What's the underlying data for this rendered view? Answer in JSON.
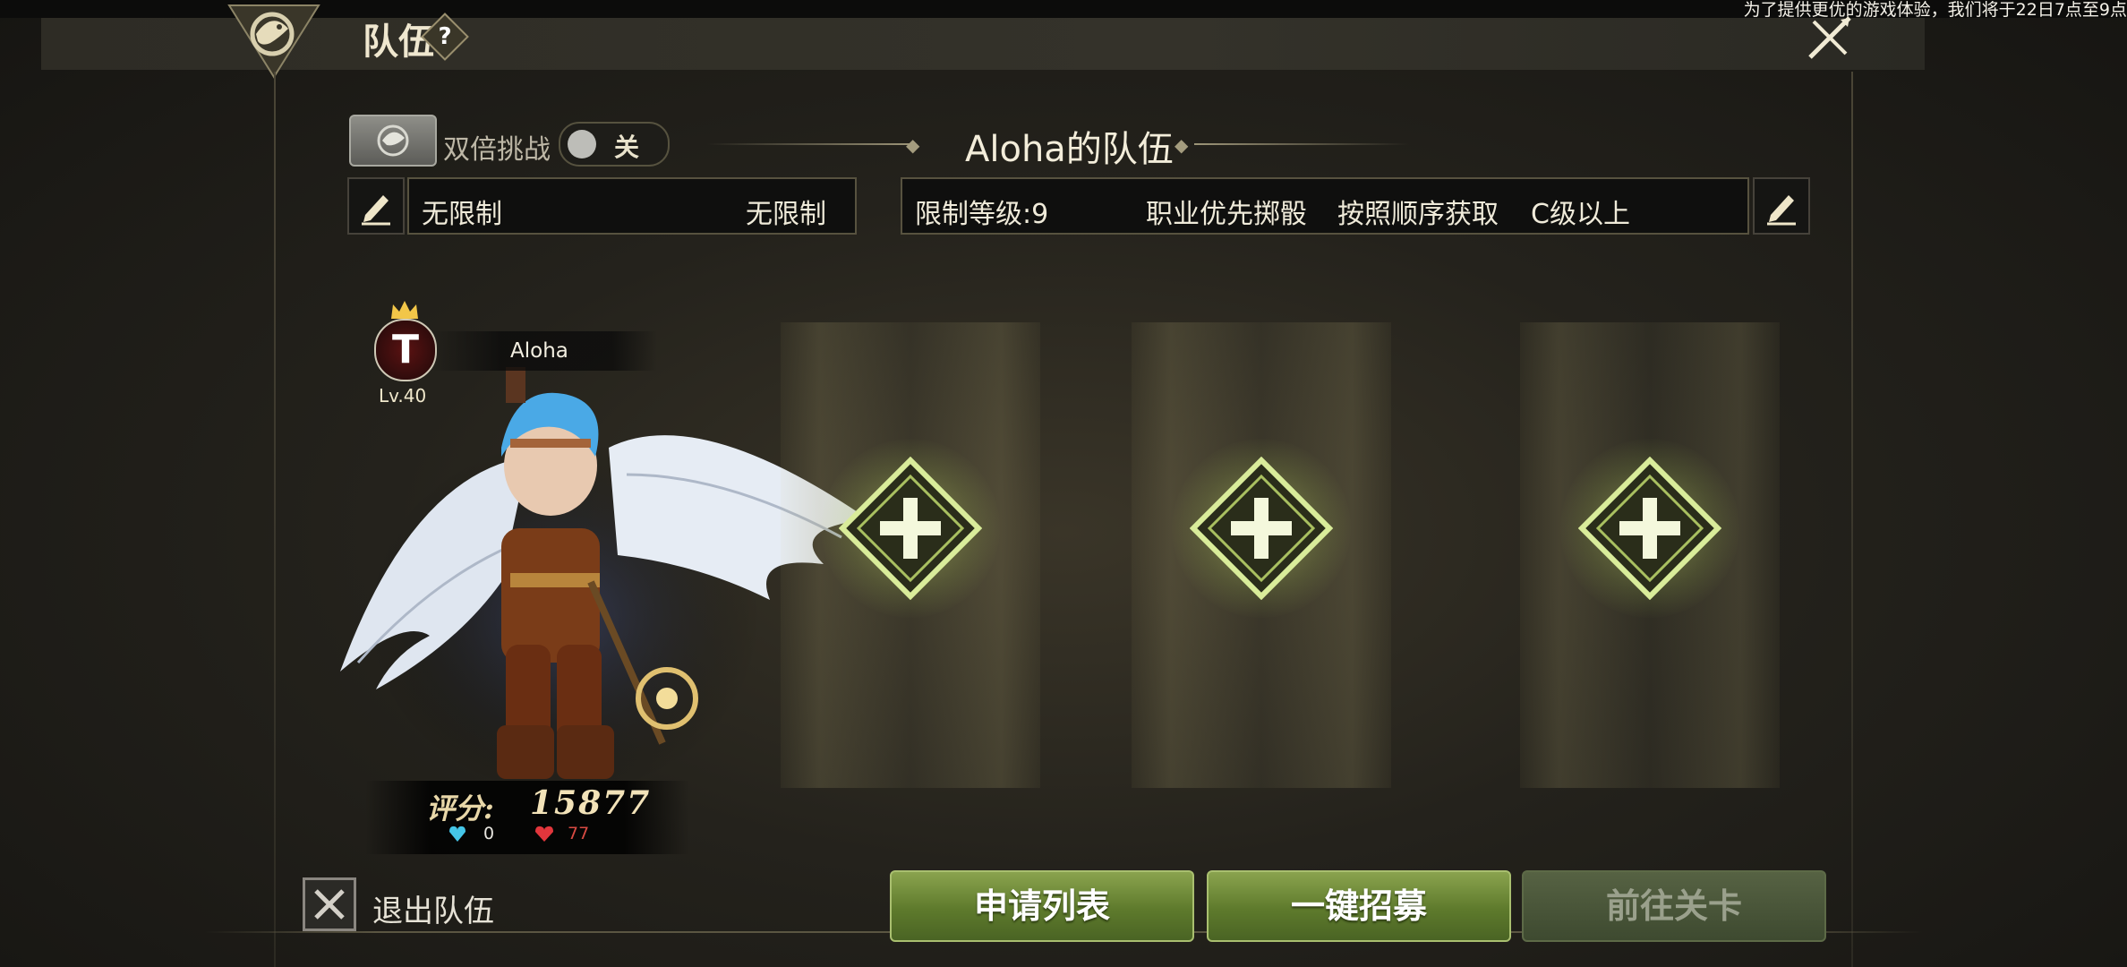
{
  "notice": "为了提供更优的游戏体验，我们将于22日7点至9点",
  "header": {
    "title": "队伍",
    "help_icon": "question-mark-icon",
    "help_text": "?",
    "logo_icon": "dragon-emblem-icon",
    "close_icon": "close-x-icon"
  },
  "double_challenge": {
    "icon": "dragon-badge-icon",
    "label": "双倍挑战",
    "toggle_state": "关"
  },
  "team": {
    "title": "Aloha的队伍"
  },
  "filters": {
    "left": {
      "edit_icon": "pencil-icon",
      "text_a": "无限制",
      "text_b": "无限制"
    },
    "right": {
      "level": "限制等级:9",
      "priority": "职业优先掷骰",
      "order": "按照顺序获取",
      "grade": "C级以上",
      "edit_icon": "pencil-icon"
    }
  },
  "leader": {
    "crown_icon": "crown-icon",
    "avatar_letter": "T",
    "name": "Aloha",
    "level": "Lv.40",
    "score_label": "评分:",
    "score_value": "15877",
    "blue_gem_icon": "blue-heart-gem-icon",
    "blue_gem_count": "0",
    "red_gem_icon": "red-heart-gem-icon",
    "red_gem_count": "77"
  },
  "slots": [
    {
      "icon": "add-member-plus-icon"
    },
    {
      "icon": "add-member-plus-icon"
    },
    {
      "icon": "add-member-plus-icon"
    }
  ],
  "bottom": {
    "exit_icon": "close-box-icon",
    "exit_label": "退出队伍",
    "apply_list": "申请列表",
    "recruit": "一键招募",
    "go_stage": "前往关卡"
  },
  "colors": {
    "accent_green": "#6d8a36",
    "disabled_green": "#4a5638",
    "gold_text": "#e8d7a8",
    "red_text": "#d84a42"
  }
}
